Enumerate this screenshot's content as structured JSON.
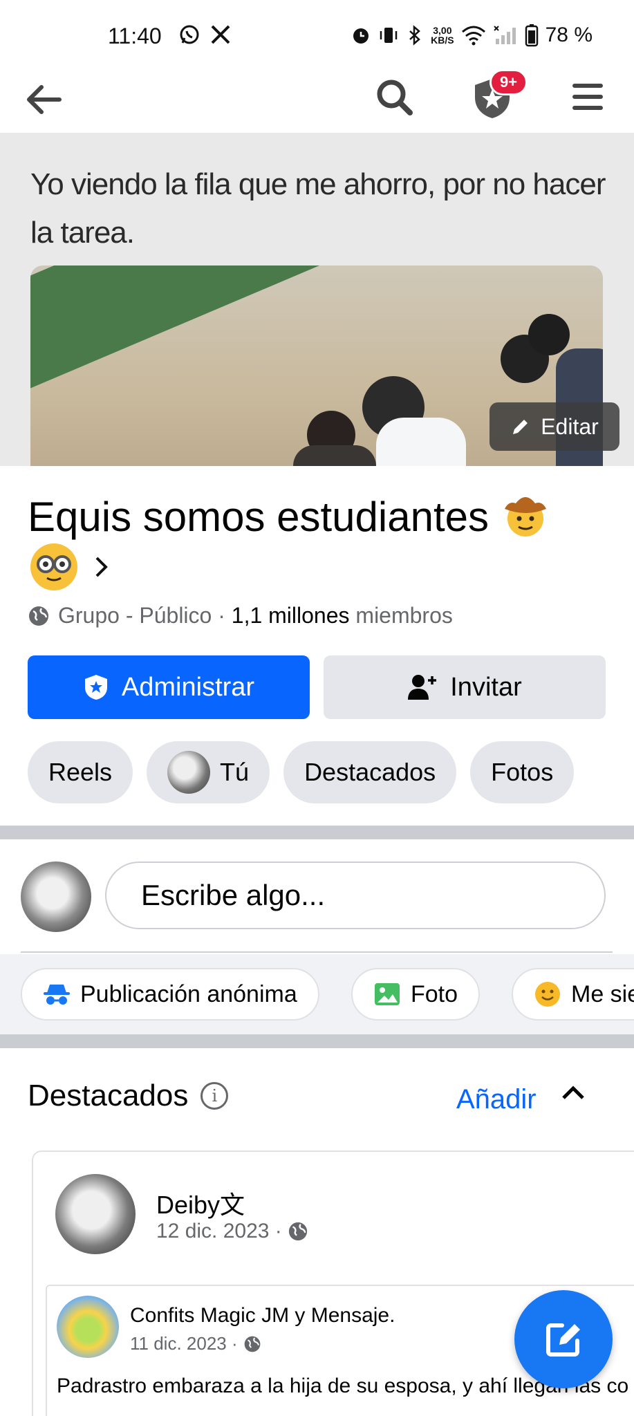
{
  "status_bar": {
    "time": "11:40",
    "speed_top": "3,00",
    "speed_unit": "KB/S",
    "battery": "78 %"
  },
  "app_bar": {
    "notification_badge": "9+"
  },
  "cover": {
    "caption": "Yo viendo la fila que me ahorro, por no hacer la tarea.",
    "edit_label": "Editar"
  },
  "group": {
    "title": "Equis somos estudiantes",
    "privacy": "Grupo - Público · ",
    "members_count": "1,1 millones",
    "members_label": " miembros"
  },
  "buttons": {
    "manage": "Administrar",
    "invite": "Invitar"
  },
  "chips": [
    {
      "label": "Reels"
    },
    {
      "label": "Tú"
    },
    {
      "label": "Destacados"
    },
    {
      "label": "Fotos"
    }
  ],
  "composer": {
    "placeholder": "Escribe algo..."
  },
  "composer_actions": [
    {
      "label": "Publicación anónima",
      "icon": "incognito-icon"
    },
    {
      "label": "Foto",
      "icon": "photo-icon"
    },
    {
      "label": "Me sie",
      "icon": "smiley-icon"
    }
  ],
  "featured": {
    "title": "Destacados",
    "add_label": "Añadir",
    "post": {
      "author": "Deiby文",
      "date": "12 dic. 2023 · ",
      "shared": {
        "author": "Confits Magic JM y Mensaje.",
        "date": "11 dic. 2023 · ",
        "text": "Padrastro embaraza a la hija de su esposa, y ahí llegan las co"
      }
    }
  },
  "colors": {
    "primary": "#0866ff",
    "fab": "#1877f2",
    "badge": "#e41e3f",
    "secondary_bg": "#e4e6eb"
  }
}
